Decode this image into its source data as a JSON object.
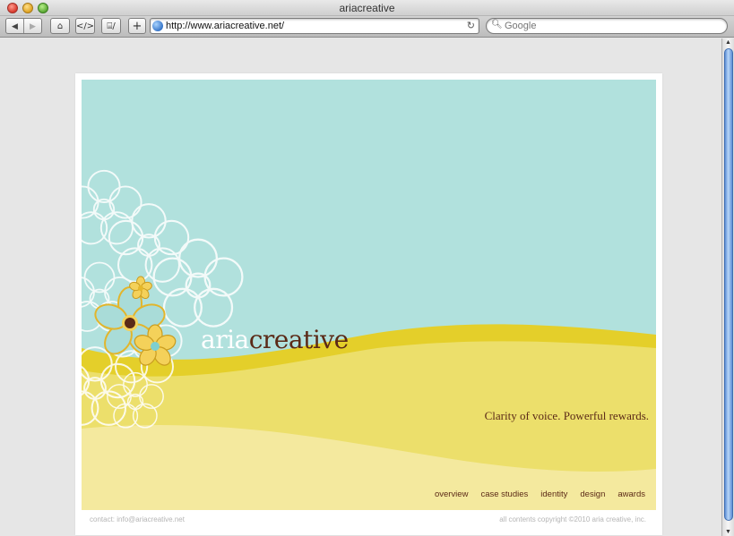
{
  "window": {
    "title": "ariacreative",
    "buttons": {
      "back": "◀",
      "forward": "▶",
      "home": "⌂",
      "source": "</>",
      "snippet": "⌸/",
      "add": "+"
    }
  },
  "address": {
    "url": "http://www.ariacreative.net/",
    "reload": "↻"
  },
  "search": {
    "placeholder": "Google"
  },
  "site": {
    "logo_light": "aria",
    "logo_dark": "creative",
    "tagline": "Clarity of voice. Powerful rewards.",
    "nav": [
      "overview",
      "case studies",
      "identity",
      "design",
      "awards"
    ],
    "contact": "contact: info@ariacreative.net",
    "copyright": "all contents copyright ©2010 aria creative, inc."
  },
  "colors": {
    "sky": "#b1e1dd",
    "hill_light": "#ecdf6b",
    "hill_edge": "#e4cf2a",
    "hill_pale": "#f4e99e",
    "brown": "#5b2a17",
    "petal_yellow": "#f4d15a"
  }
}
